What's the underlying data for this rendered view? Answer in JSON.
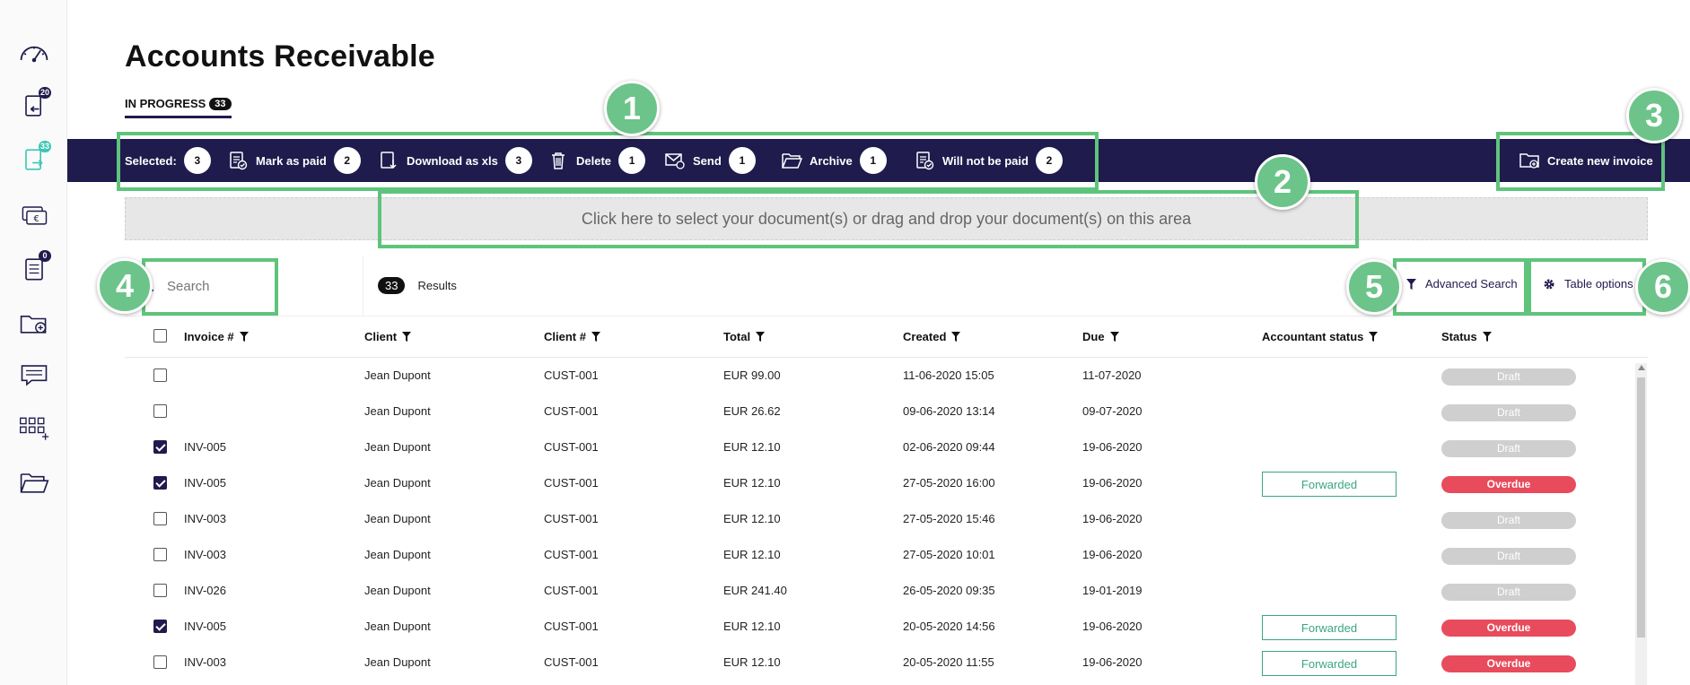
{
  "sidebar": {
    "icons": [
      {
        "name": "dashboard-gauge-icon"
      },
      {
        "name": "incoming-documents-icon",
        "badge": "20"
      },
      {
        "name": "outgoing-documents-icon",
        "badge": "33"
      },
      {
        "name": "euro-cards-icon"
      },
      {
        "name": "task-list-icon",
        "badge": "0"
      },
      {
        "name": "add-folder-icon"
      },
      {
        "name": "messages-icon"
      },
      {
        "name": "add-grid-icon"
      },
      {
        "name": "folder-open-icon"
      }
    ]
  },
  "page": {
    "title": "Accounts Receivable",
    "tab_label": "IN PROGRESS",
    "tab_count": "33"
  },
  "toolbar": {
    "selected_label": "Selected:",
    "selected_count": "3",
    "mark_as_paid_label": "Mark as paid",
    "mark_as_paid_count": "2",
    "download_label": "Download as xls",
    "download_count": "3",
    "delete_label": "Delete",
    "delete_count": "1",
    "send_label": "Send",
    "send_count": "1",
    "archive_label": "Archive",
    "archive_count": "1",
    "will_not_be_paid_label": "Will not be paid",
    "will_not_be_paid_count": "2",
    "create_invoice_label": "Create new invoice"
  },
  "dropzone": {
    "text": "Click here to select your document(s) or drag and drop your document(s) on this area"
  },
  "search": {
    "placeholder": "Search",
    "results_count": "33",
    "results_label": "Results",
    "advanced_search_label": "Advanced Search",
    "table_options_label": "Table options"
  },
  "table": {
    "headers": [
      "Invoice #",
      "Client",
      "Client #",
      "Total",
      "Created",
      "Due",
      "Accountant status",
      "Status"
    ],
    "rows": [
      {
        "checked": false,
        "invoice": "",
        "client": "Jean Dupont",
        "client_no": "CUST-001",
        "total": "EUR 99.00",
        "created": "11-06-2020 15:05",
        "due": "11-07-2020",
        "accountant": "",
        "status": "Draft"
      },
      {
        "checked": false,
        "invoice": "",
        "client": "Jean Dupont",
        "client_no": "CUST-001",
        "total": "EUR 26.62",
        "created": "09-06-2020 13:14",
        "due": "09-07-2020",
        "accountant": "",
        "status": "Draft"
      },
      {
        "checked": true,
        "invoice": "INV-005",
        "client": "Jean Dupont",
        "client_no": "CUST-001",
        "total": "EUR 12.10",
        "created": "02-06-2020 09:44",
        "due": "19-06-2020",
        "accountant": "",
        "status": "Draft"
      },
      {
        "checked": true,
        "invoice": "INV-005",
        "client": "Jean Dupont",
        "client_no": "CUST-001",
        "total": "EUR 12.10",
        "created": "27-05-2020 16:00",
        "due": "19-06-2020",
        "accountant": "Forwarded",
        "status": "Overdue"
      },
      {
        "checked": false,
        "invoice": "INV-003",
        "client": "Jean Dupont",
        "client_no": "CUST-001",
        "total": "EUR 12.10",
        "created": "27-05-2020 15:46",
        "due": "19-06-2020",
        "accountant": "",
        "status": "Draft"
      },
      {
        "checked": false,
        "invoice": "INV-003",
        "client": "Jean Dupont",
        "client_no": "CUST-001",
        "total": "EUR 12.10",
        "created": "27-05-2020 10:01",
        "due": "19-06-2020",
        "accountant": "",
        "status": "Draft"
      },
      {
        "checked": false,
        "invoice": "INV-026",
        "client": "Jean Dupont",
        "client_no": "CUST-001",
        "total": "EUR 241.40",
        "created": "26-05-2020 09:35",
        "due": "19-01-2019",
        "accountant": "",
        "status": "Draft"
      },
      {
        "checked": true,
        "invoice": "INV-005",
        "client": "Jean Dupont",
        "client_no": "CUST-001",
        "total": "EUR 12.10",
        "created": "20-05-2020 14:56",
        "due": "19-06-2020",
        "accountant": "Forwarded",
        "status": "Overdue"
      },
      {
        "checked": false,
        "invoice": "INV-003",
        "client": "Jean Dupont",
        "client_no": "CUST-001",
        "total": "EUR 12.10",
        "created": "20-05-2020 11:55",
        "due": "19-06-2020",
        "accountant": "Forwarded",
        "status": "Overdue"
      }
    ]
  },
  "annotations": [
    "1",
    "2",
    "3",
    "4",
    "5",
    "6"
  ],
  "colors": {
    "navy": "#1f1b4d",
    "highlight": "#5fc47b",
    "overdue": "#e84b5c",
    "forwarded": "#3aa781",
    "draft": "#cfcfcf"
  }
}
